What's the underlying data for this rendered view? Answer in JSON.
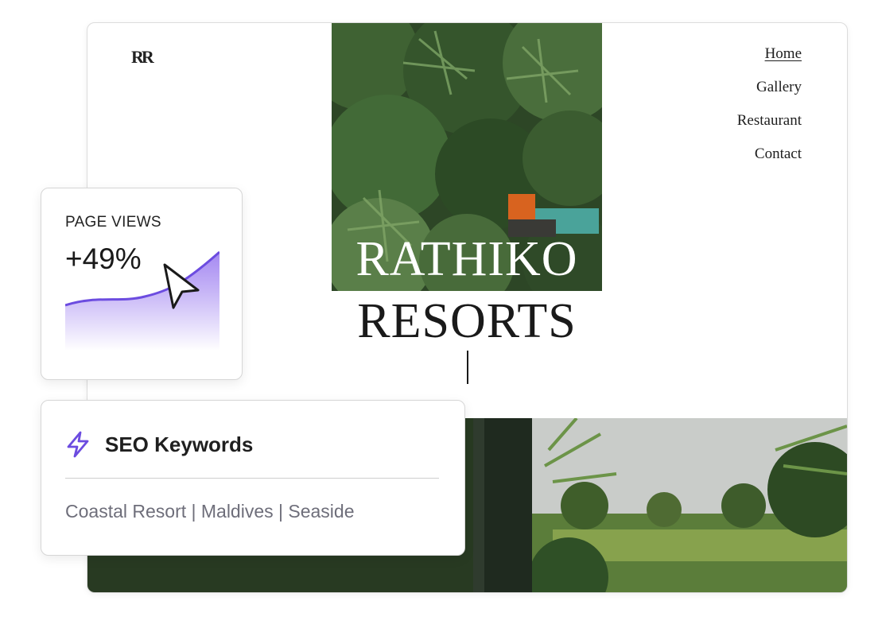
{
  "site": {
    "logo": "RR",
    "nav": {
      "items": [
        {
          "label": "Home",
          "active": true
        },
        {
          "label": "Gallery",
          "active": false
        },
        {
          "label": "Restaurant",
          "active": false
        },
        {
          "label": "Contact",
          "active": false
        }
      ]
    },
    "title_line1": "RATHIKO",
    "title_line2": "RESORTS"
  },
  "page_views": {
    "label": "PAGE VIEWS",
    "value": "+49%",
    "accent": "#6c4ce0"
  },
  "seo": {
    "title": "SEO Keywords",
    "keywords": "Coastal Resort | Maldives | Seaside",
    "icon": "lightning-icon"
  }
}
